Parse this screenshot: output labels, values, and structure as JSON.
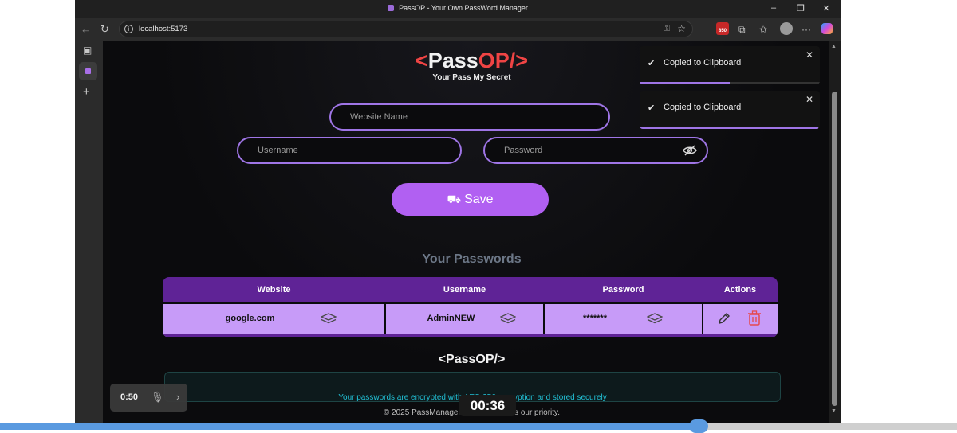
{
  "window": {
    "title": "PassOP - Your Own PassWord Manager",
    "url": "localhost:5173"
  },
  "app": {
    "logo": {
      "open": "<",
      "pass": "Pass",
      "op": "OP",
      "close": "/>"
    },
    "tagline": "Your Pass My Secret",
    "form": {
      "website_placeholder": "Website Name",
      "username_placeholder": "Username",
      "password_placeholder": "Password",
      "save_label": "Save"
    },
    "passwords_title": "Your Passwords",
    "table": {
      "headers": [
        "Website",
        "Username",
        "Password",
        "Actions"
      ],
      "rows": [
        {
          "website": "google.com",
          "username": "AdminNEW",
          "password": "*******"
        }
      ]
    },
    "footer": {
      "notice": "Your passwords are encrypted with AES-256 encryption and stored securely",
      "copyright": "© 2025 PassManager. Your security is our priority."
    }
  },
  "toasts": [
    {
      "message": "Copied to Clipboard",
      "progress": 0.5
    },
    {
      "message": "Copied to Clipboard",
      "progress": 0.99
    }
  ],
  "video": {
    "elapsed": "0:50",
    "clock": "00:36",
    "progress": 0.73
  },
  "colors": {
    "accent": "#b160f2",
    "header": "#5f2396",
    "row": "#c79bf8",
    "brand_red": "#ef4444"
  }
}
